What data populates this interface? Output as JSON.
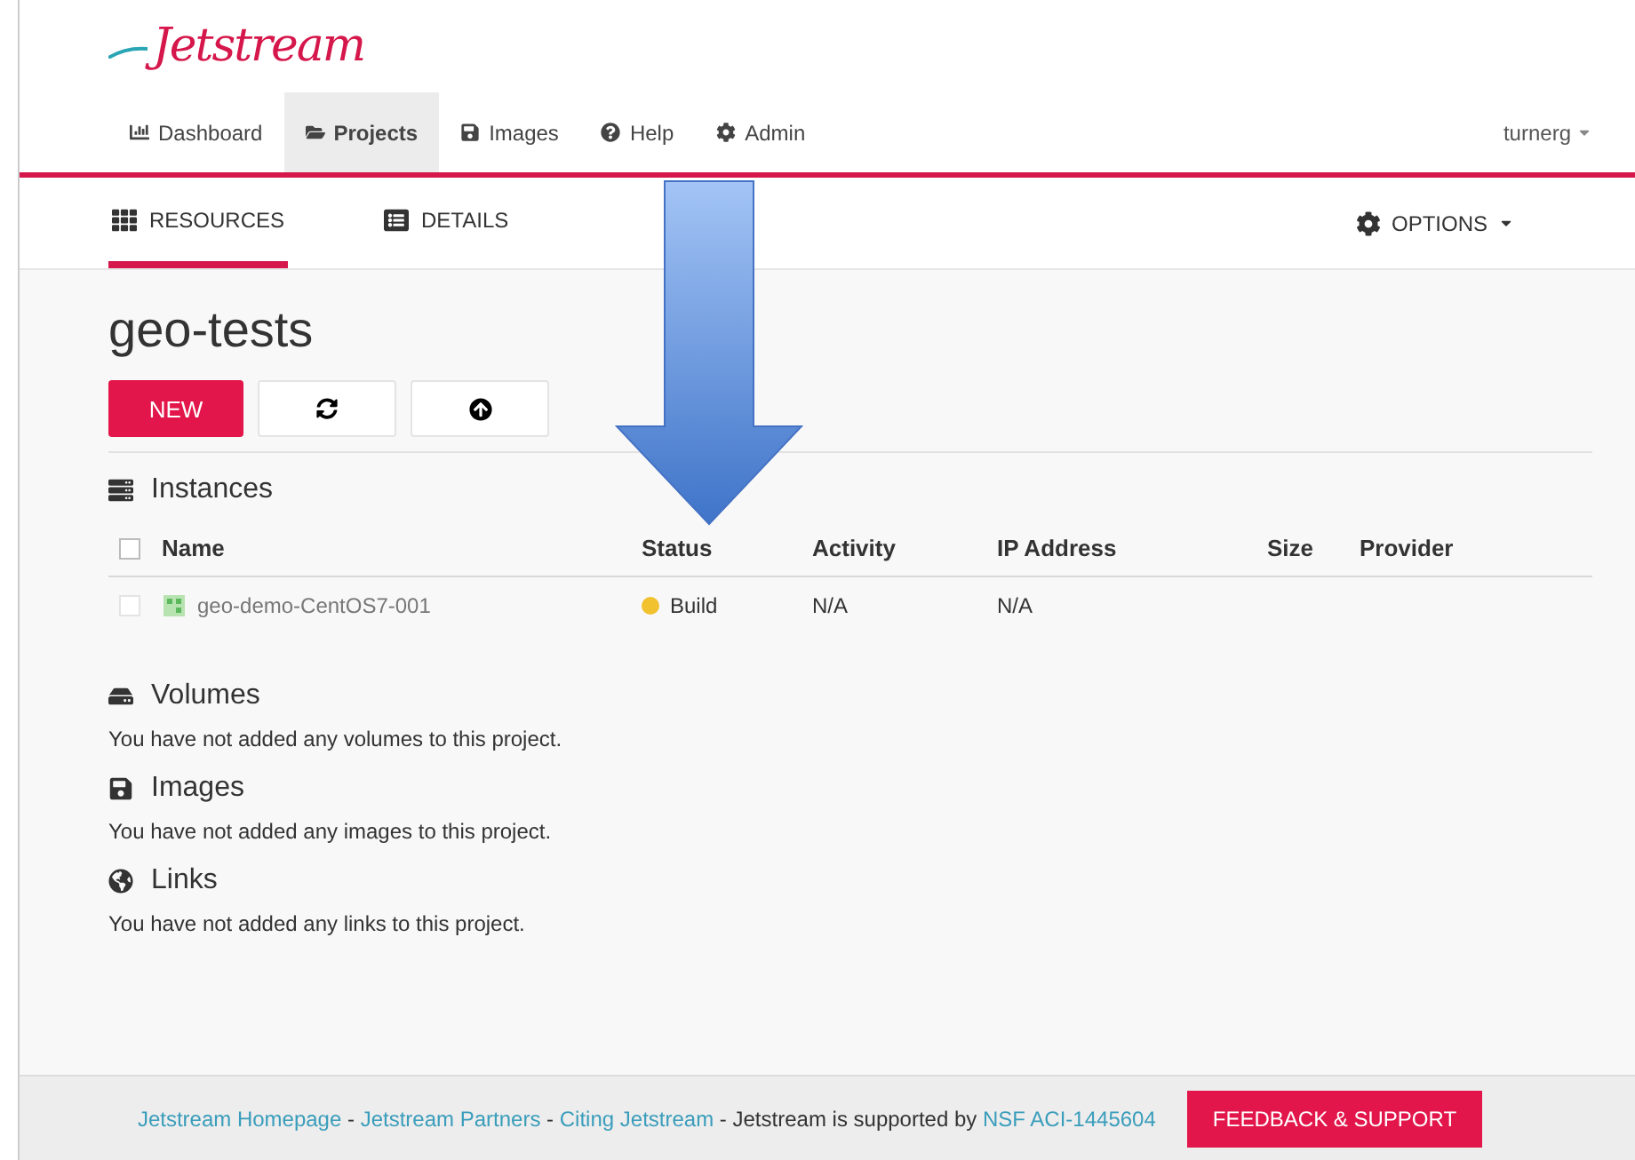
{
  "logo": "Jetstream",
  "nav": [
    {
      "label": "Dashboard",
      "selected": false
    },
    {
      "label": "Projects",
      "selected": true
    },
    {
      "label": "Images",
      "selected": false
    },
    {
      "label": "Help",
      "selected": false
    },
    {
      "label": "Admin",
      "selected": false
    }
  ],
  "user_menu": "turnerg",
  "subtabs": [
    {
      "label": "RESOURCES",
      "selected": true
    },
    {
      "label": "DETAILS",
      "selected": false
    }
  ],
  "options_menu": "OPTIONS",
  "project_title": "geo-tests",
  "new_button": "NEW",
  "instances": {
    "title": "Instances",
    "select_all_checked": false,
    "columns": [
      "Name",
      "Status",
      "Activity",
      "IP Address",
      "Size",
      "Provider"
    ],
    "rows": [
      {
        "checked": false,
        "name": "geo-demo-CentOS7-001",
        "status": "Build",
        "color": "#f2c12e",
        "activity": "N/A",
        "ip": "N/A"
      }
    ]
  },
  "sections": [
    {
      "title": "Volumes",
      "message": "You have not added any volumes to this project."
    },
    {
      "title": "Images",
      "message": "You have not added any images to this project."
    },
    {
      "title": "Links",
      "message": "You have not added any links to this project."
    }
  ],
  "footer": {
    "items": [
      {
        "kind": "link",
        "text": "Jetstream Homepage"
      },
      {
        "kind": "text",
        "text": " - "
      },
      {
        "kind": "link",
        "text": "Jetstream Partners"
      },
      {
        "kind": "text",
        "text": " - "
      },
      {
        "kind": "link",
        "text": "Citing Jetstream"
      },
      {
        "kind": "text",
        "text": " - Jetstream is supported by "
      },
      {
        "kind": "link",
        "text": "NSF ACI-1445604"
      }
    ],
    "button": "FEEDBACK & SUPPORT"
  }
}
